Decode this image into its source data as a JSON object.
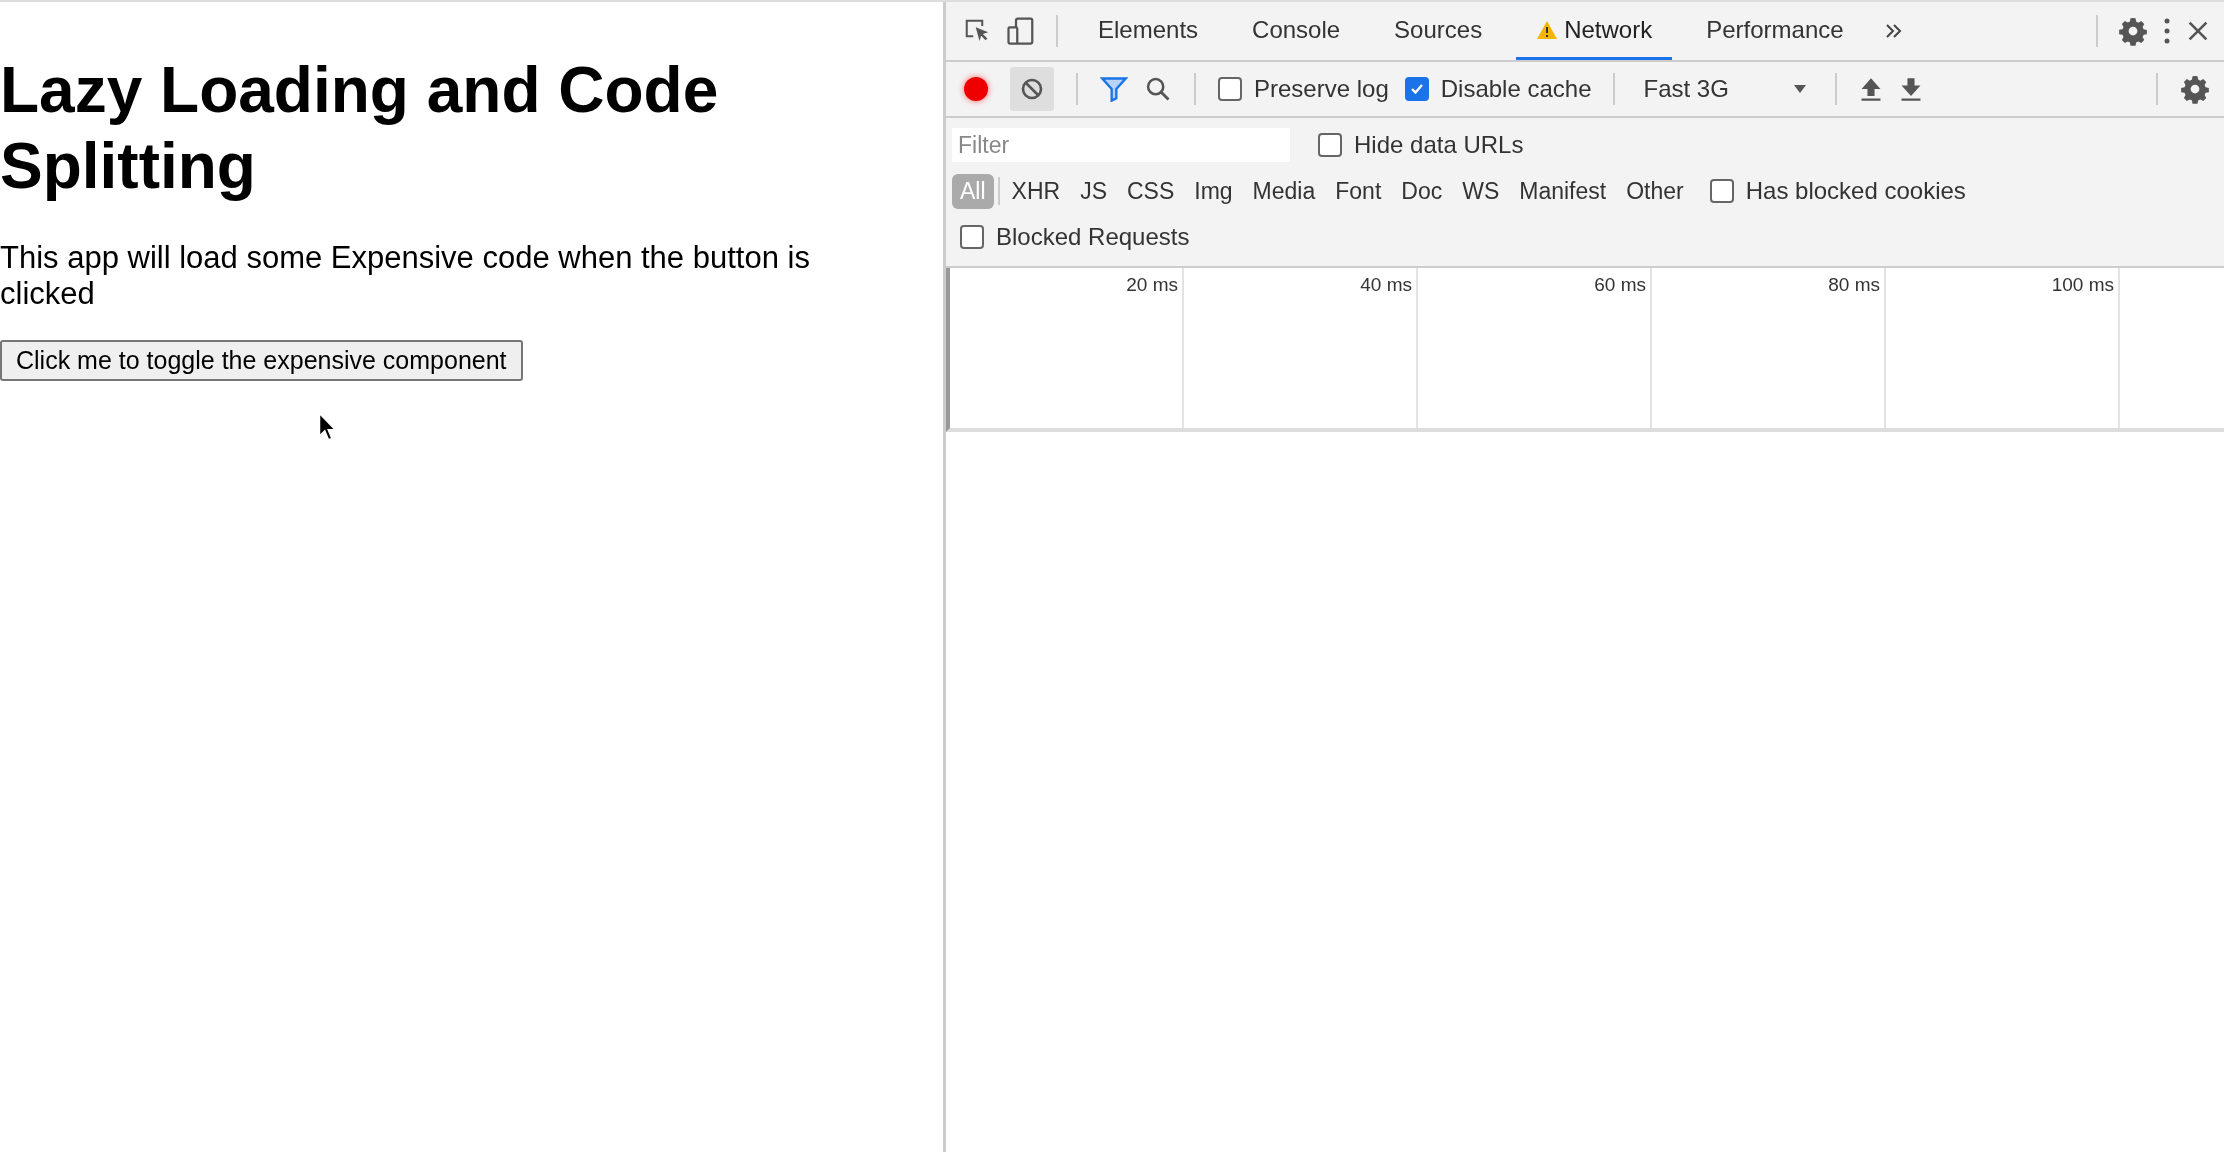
{
  "page": {
    "heading": "Lazy Loading and Code Splitting",
    "paragraph": "This app will load some Expensive code when the button is clicked",
    "button": "Click me to toggle the expensive component"
  },
  "devtools": {
    "tabs": [
      {
        "label": "Elements",
        "selected": false,
        "warning": false
      },
      {
        "label": "Console",
        "selected": false,
        "warning": false
      },
      {
        "label": "Sources",
        "selected": false,
        "warning": false
      },
      {
        "label": "Network",
        "selected": true,
        "warning": true
      },
      {
        "label": "Performance",
        "selected": false,
        "warning": false
      }
    ],
    "toolbar": {
      "recording": true,
      "preserve_log": {
        "label": "Preserve log",
        "checked": false
      },
      "disable_cache": {
        "label": "Disable cache",
        "checked": true
      },
      "throttling": "Fast 3G"
    },
    "filter": {
      "placeholder": "Filter"
    },
    "hide_data_urls": {
      "label": "Hide data URLs",
      "checked": false
    },
    "types": [
      {
        "label": "All",
        "selected": true
      },
      {
        "label": "XHR",
        "selected": false
      },
      {
        "label": "JS",
        "selected": false
      },
      {
        "label": "CSS",
        "selected": false
      },
      {
        "label": "Img",
        "selected": false
      },
      {
        "label": "Media",
        "selected": false
      },
      {
        "label": "Font",
        "selected": false
      },
      {
        "label": "Doc",
        "selected": false
      },
      {
        "label": "WS",
        "selected": false
      },
      {
        "label": "Manifest",
        "selected": false
      },
      {
        "label": "Other",
        "selected": false
      }
    ],
    "has_blocked_cookies": {
      "label": "Has blocked cookies",
      "checked": false
    },
    "blocked_requests": {
      "label": "Blocked Requests",
      "checked": false
    },
    "timeline_ticks": [
      "20 ms",
      "40 ms",
      "60 ms",
      "80 ms",
      "100 ms"
    ]
  }
}
